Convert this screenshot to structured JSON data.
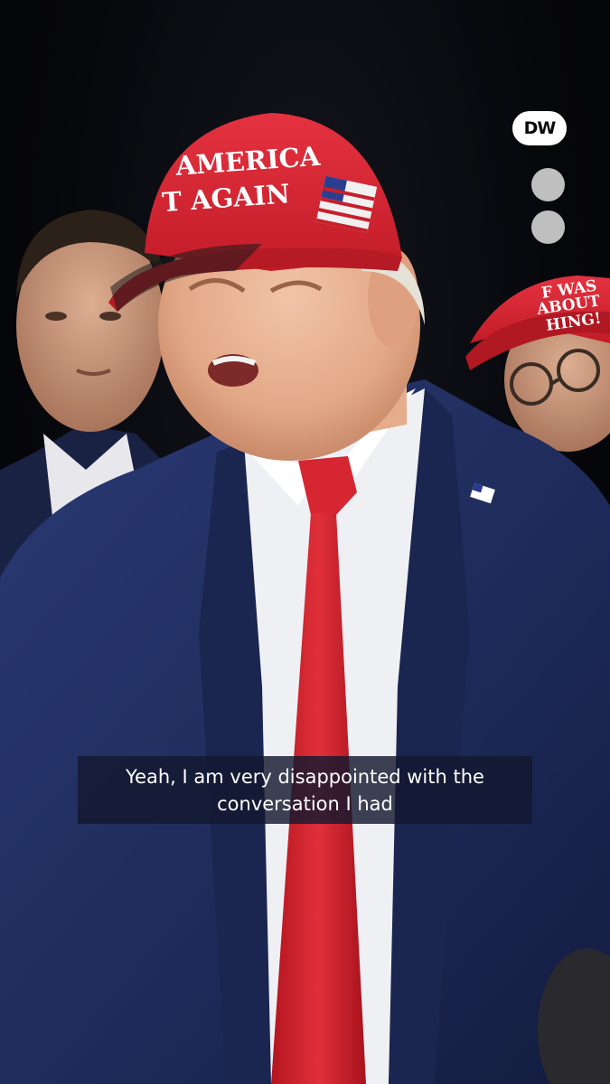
{
  "brand": {
    "logo_text": "DW"
  },
  "scene": {
    "hat_main_line1": "AMERICA",
    "hat_main_line2": "T AGAIN",
    "hat_right_line1": "F WAS",
    "hat_right_line2": "ABOUT",
    "hat_right_line3": "HING!"
  },
  "caption": {
    "line1": "Yeah, I am very disappointed with the",
    "line2": "conversation I had"
  },
  "colors": {
    "hat_red": "#d8232f",
    "suit_navy": "#1f2c5c",
    "tie_red": "#c8202a",
    "caption_bg": "#141830"
  }
}
